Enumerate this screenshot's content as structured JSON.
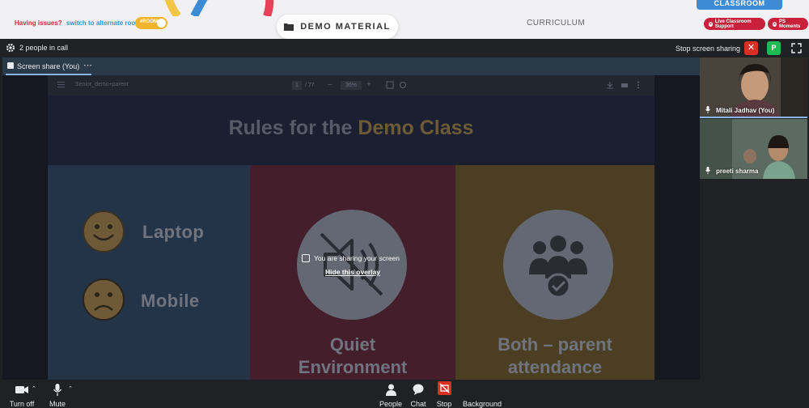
{
  "topbar": {
    "issues_text": "Having issues?",
    "alt_room_link": "switch to alternate room",
    "room_toggle_label": "#ROOM",
    "demo_material_label": "DEMO MATERIAL",
    "curriculum_label": "CURRICULUM",
    "classroom_label": "CLASSROOM",
    "live_support_label": "Live Classroom Support",
    "ps_moments_label": "PS Moments"
  },
  "call": {
    "people_in_call": "2 people in call",
    "stop_sharing_label": "Stop screen sharing",
    "presenter_badge": "P",
    "share_tab_label": "Screen share (You)",
    "more_icon": "⋯"
  },
  "viewer": {
    "doc_name": "Senior_demo+parent",
    "page_current": "1",
    "page_total": "/ 77",
    "zoom": "36%",
    "minus": "–",
    "plus": "+"
  },
  "slide": {
    "title_prefix": "Rules for the ",
    "title_highlight": "Demo Class",
    "col1_item1": "Laptop",
    "col1_item2": "Mobile",
    "col2_line1": "Quiet",
    "col2_line2": "Environment",
    "col3_line1": "Both – parent",
    "col3_line2": "attendance"
  },
  "overlay": {
    "message": "You are sharing your screen",
    "hide_link": "Hide this overlay"
  },
  "participants": [
    {
      "name": "Mitali Jadhav (You)"
    },
    {
      "name": "preeti sharma"
    }
  ],
  "controls": {
    "camera": "Turn off",
    "mic": "Mute",
    "people": "People",
    "chat": "Chat",
    "stop": "Stop",
    "background": "Background"
  },
  "colors": {
    "accent_red": "#d93025",
    "presenter_green": "#1db954",
    "link_blue": "#2f95c9"
  }
}
